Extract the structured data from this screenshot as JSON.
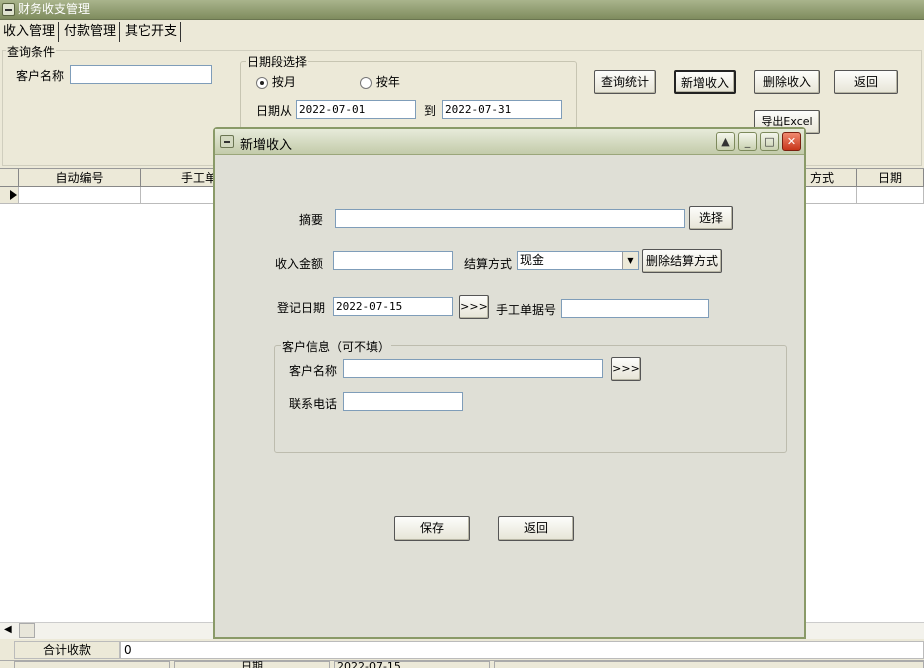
{
  "window": {
    "title": "财务收支管理"
  },
  "tabs": [
    "收入管理",
    "付款管理",
    "其它开支"
  ],
  "query": {
    "group_label": "查询条件",
    "customer_label": "客户名称",
    "customer_value": "",
    "date_group_label": "日期段选择",
    "radio_month": "按月",
    "radio_year": "按年",
    "selected": "按月",
    "date_from_label": "日期从",
    "date_from": "2022-07-01",
    "date_to_label": "到",
    "date_to": "2022-07-31"
  },
  "toolbar": {
    "query": "查询统计",
    "add": "新增收入",
    "delete": "删除收入",
    "back": "返回",
    "export": "导出Excel"
  },
  "grid": {
    "columns": [
      "自动编号",
      "手工单",
      "方式",
      "日期"
    ]
  },
  "summary": {
    "label": "合计收款",
    "value": "0"
  },
  "status_bar": {
    "date_label": "日期",
    "date_value": "2022-07-15"
  },
  "dialog": {
    "title": "新增收入",
    "summary_label": "摘要",
    "summary_value": "",
    "select_button": "选择",
    "amount_label": "收入金额",
    "amount_value": "",
    "settle_label": "结算方式",
    "settle_value": "现金",
    "delete_settle_button": "删除结算方式",
    "reg_date_label": "登记日期",
    "reg_date_value": "2022-07-15",
    "picker_button": ">>>",
    "manual_no_label": "手工单据号",
    "manual_no_value": "",
    "customer_group_label": "客户信息（可不填）",
    "customer_name_label": "客户名称",
    "customer_name_value": "",
    "customer_picker_button": ">>>",
    "phone_label": "联系电话",
    "phone_value": "",
    "save_button": "保存",
    "back_button": "返回"
  }
}
